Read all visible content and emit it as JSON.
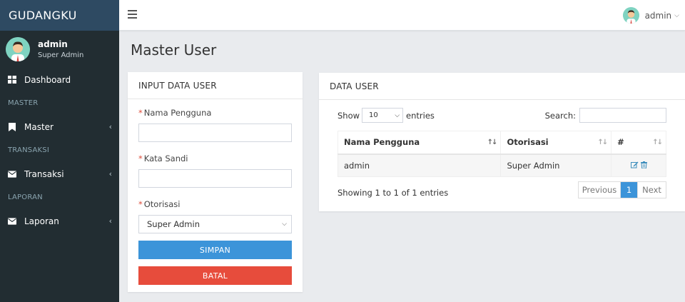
{
  "app": {
    "brand": "GUDANGKU"
  },
  "user": {
    "name": "admin",
    "role": "Super Admin"
  },
  "topbar": {
    "user_label": "admin"
  },
  "sidebar": {
    "items": [
      {
        "type": "item",
        "label": "Dashboard",
        "icon": "dashboard-icon"
      },
      {
        "type": "header",
        "label": "MASTER"
      },
      {
        "type": "item",
        "label": "Master",
        "icon": "bookmark-icon"
      },
      {
        "type": "header",
        "label": "TRANSAKSI"
      },
      {
        "type": "item",
        "label": "Transaksi",
        "icon": "envelope-icon"
      },
      {
        "type": "header",
        "label": "LAPORAN"
      },
      {
        "type": "item",
        "label": "Laporan",
        "icon": "envelope-icon"
      }
    ]
  },
  "page": {
    "title": "Master User"
  },
  "form": {
    "title": "INPUT DATA USER",
    "fields": {
      "username_label": "Nama Pengguna",
      "username_value": "",
      "password_label": "Kata Sandi",
      "password_value": "",
      "role_label": "Otorisasi",
      "role_value": "Super Admin"
    },
    "save_label": "SIMPAN",
    "cancel_label": "BATAL"
  },
  "table": {
    "title": "DATA USER",
    "show_label": "Show",
    "entries_value": "10",
    "entries_label": "entries",
    "search_label": "Search:",
    "search_value": "",
    "columns": [
      "Nama Pengguna",
      "Otorisasi",
      "#"
    ],
    "rows": [
      {
        "name": "admin",
        "role": "Super Admin"
      }
    ],
    "info": "Showing 1 to 1 of 1 entries",
    "pager": {
      "prev": "Previous",
      "current": "1",
      "next": "Next"
    }
  },
  "colors": {
    "sidebar_bg": "#222d32",
    "primary": "#3c94d9",
    "danger": "#e74c3c",
    "required": "#dd4b39"
  }
}
